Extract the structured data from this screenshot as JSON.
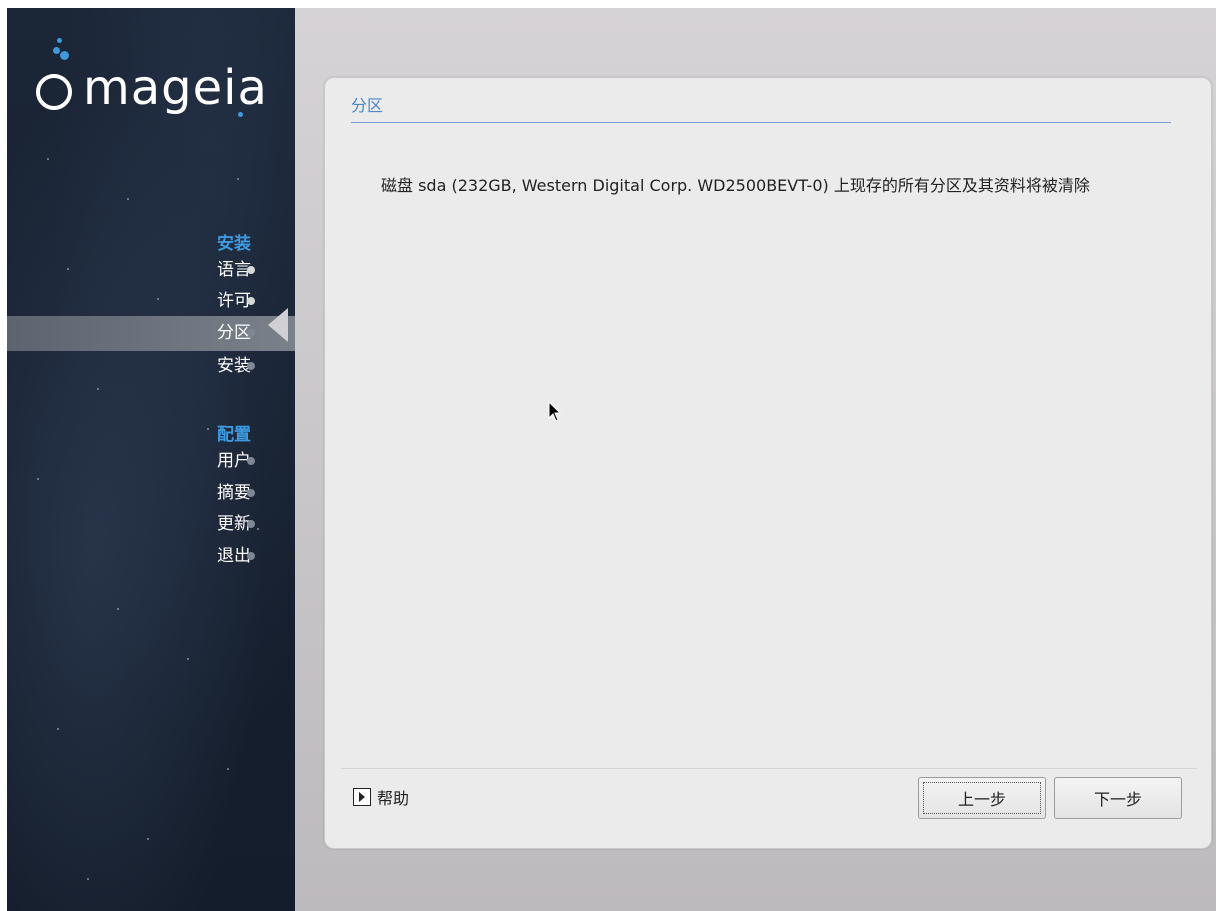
{
  "sidebar": {
    "logo_text": "mageia",
    "sections": [
      {
        "title": "安装",
        "steps": [
          {
            "label": "语言",
            "state": "done"
          },
          {
            "label": "许可",
            "state": "done"
          },
          {
            "label": "分区",
            "state": "current"
          },
          {
            "label": "安装",
            "state": "pending"
          }
        ]
      },
      {
        "title": "配置",
        "steps": [
          {
            "label": "用户",
            "state": "pending"
          },
          {
            "label": "摘要",
            "state": "pending"
          },
          {
            "label": "更新",
            "state": "pending"
          },
          {
            "label": "退出",
            "state": "pending"
          }
        ]
      }
    ]
  },
  "panel": {
    "title": "分区",
    "message": "磁盘 sda (232GB, Western Digital Corp. WD2500BEVT-0) 上现存的所有分区及其资料将被清除"
  },
  "footer": {
    "help_label": "帮助",
    "back_label": "上一步",
    "next_label": "下一步"
  },
  "colors": {
    "accent": "#3c9be0",
    "panel_title": "#4b86c6",
    "sidebar_bg": "#172131"
  }
}
